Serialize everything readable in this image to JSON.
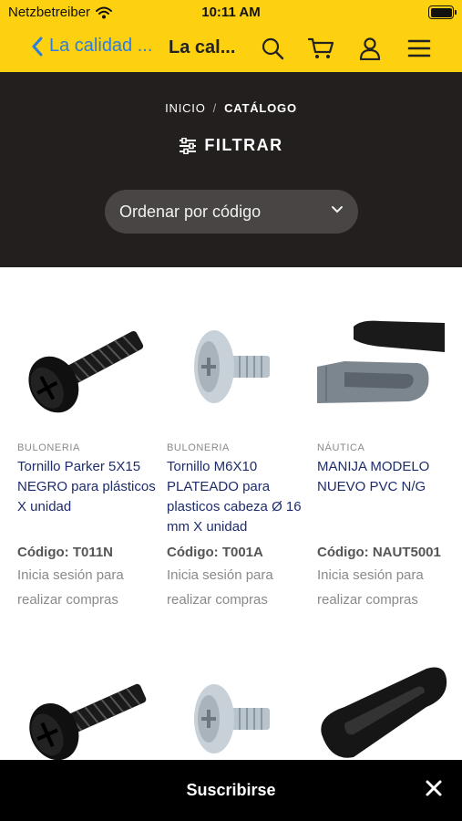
{
  "status_bar": {
    "carrier": "Netzbetreiber",
    "time": "10:11 AM"
  },
  "header": {
    "back_label": "La calidad ...",
    "title": "La cal...",
    "accent_color": "#fdd10f",
    "back_color": "#2a7de1",
    "icons": [
      "search-icon",
      "cart-icon",
      "user-icon",
      "menu-icon"
    ]
  },
  "breadcrumb": {
    "home": "INICIO",
    "separator": "/",
    "current": "CATÁLOGO"
  },
  "filter": {
    "label": "FILTRAR"
  },
  "sort": {
    "selected": "Ordenar por código"
  },
  "products": [
    {
      "category": "BULONERIA",
      "name": "Tornillo Parker 5X15 NEGRO para plásticos X unidad",
      "code": "Código: T011N",
      "info": "Inicia sesión para realizar compras"
    },
    {
      "category": "BULONERIA",
      "name": "Tornillo M6X10 PLATEADO para plasticos cabeza Ø 16 mm X unidad",
      "code": "Código: T001A",
      "info": "Inicia sesión para realizar compras"
    },
    {
      "category": "NÁUTICA",
      "name": "MANIJA MODELO NUEVO PVC N/G",
      "code": "Código: NAUT5001",
      "info": "Inicia sesión para realizar compras"
    }
  ],
  "subscribe": {
    "label": "Suscribirse"
  }
}
